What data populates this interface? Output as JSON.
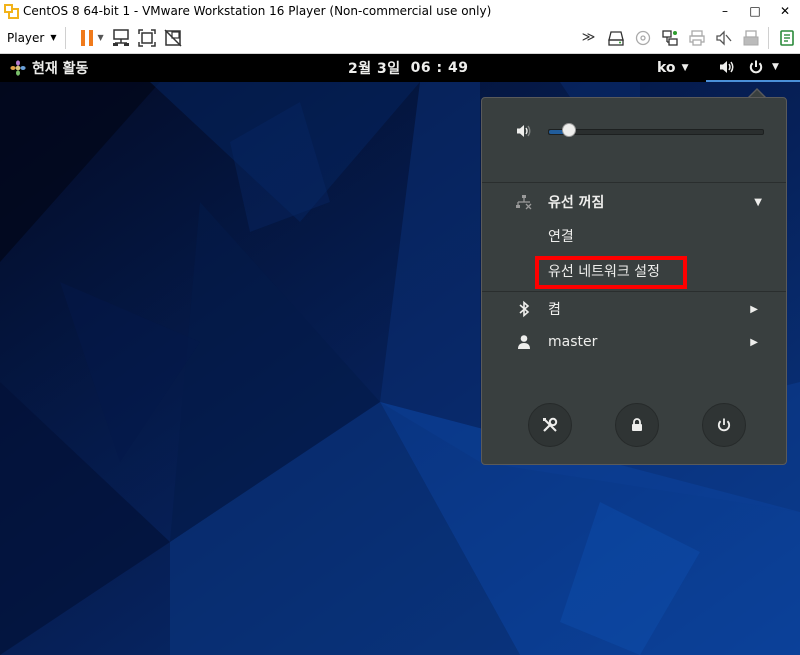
{
  "window": {
    "title": "CentOS 8 64-bit 1 - VMware Workstation 16 Player (Non-commercial use only)",
    "minimize_glyph": "–",
    "maximize_glyph": "□",
    "close_glyph": "✕"
  },
  "toolbar": {
    "player_label": "Player",
    "player_caret": "▼",
    "pause_caret": "▼"
  },
  "topbar": {
    "activities_label": "현재 활동",
    "date": "2월 3일",
    "time": "06 : 49",
    "language": "ko",
    "caret": "▼"
  },
  "system_menu": {
    "volume_level": 0.1,
    "network": {
      "title": "유선 꺼짐",
      "items": [
        "연결",
        "유선 네트워크 설정"
      ]
    },
    "bluetooth_label": "켬",
    "user_label": "master",
    "submenu_arrow": "▶",
    "expand_arrow": "▼"
  },
  "colors": {
    "accent": "#4a90d9",
    "menu_bg": "#393f3f",
    "highlight": "#ff0000"
  }
}
